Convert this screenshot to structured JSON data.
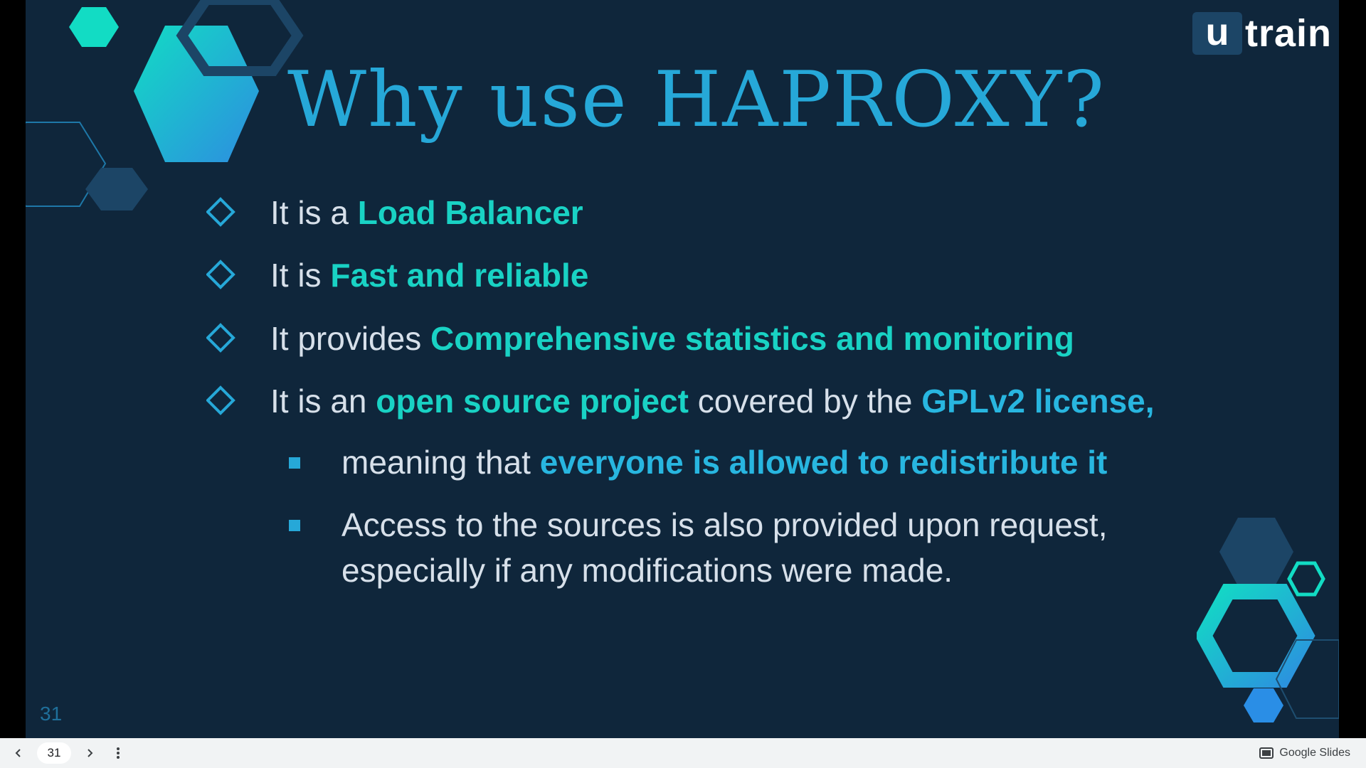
{
  "slide": {
    "title": "Why use HAPROXY?",
    "logo": {
      "u": "u",
      "word": "train"
    },
    "bullets": [
      {
        "pre": "It is a ",
        "hl": "Load Balancer"
      },
      {
        "pre": "It is ",
        "hl": "Fast and reliable"
      },
      {
        "pre": "It provides ",
        "hl": "Comprehensive statistics and monitoring"
      },
      {
        "pre": "It is an ",
        "hl": "open source project",
        "mid": " covered by the ",
        "hl2": "GPLv2 license,"
      }
    ],
    "sub_bullets": [
      {
        "pre": "meaning that ",
        "hl": "everyone is allowed to redistribute it"
      },
      {
        "line1": "Access to the sources is also provided upon request,",
        "line2": "especially if any modifications were made."
      }
    ],
    "slide_number": "31"
  },
  "bottom_bar": {
    "prev_icon": "chevron-left-icon",
    "current_page": "31",
    "next_icon": "chevron-right-icon",
    "more_icon": "more-vert-icon",
    "brand": "Google Slides"
  },
  "colors": {
    "background": "#0f263b",
    "title": "#26a8d8",
    "highlight": "#19d2c4",
    "highlight_blue": "#28b6e0",
    "text": "#d7e0ea"
  }
}
